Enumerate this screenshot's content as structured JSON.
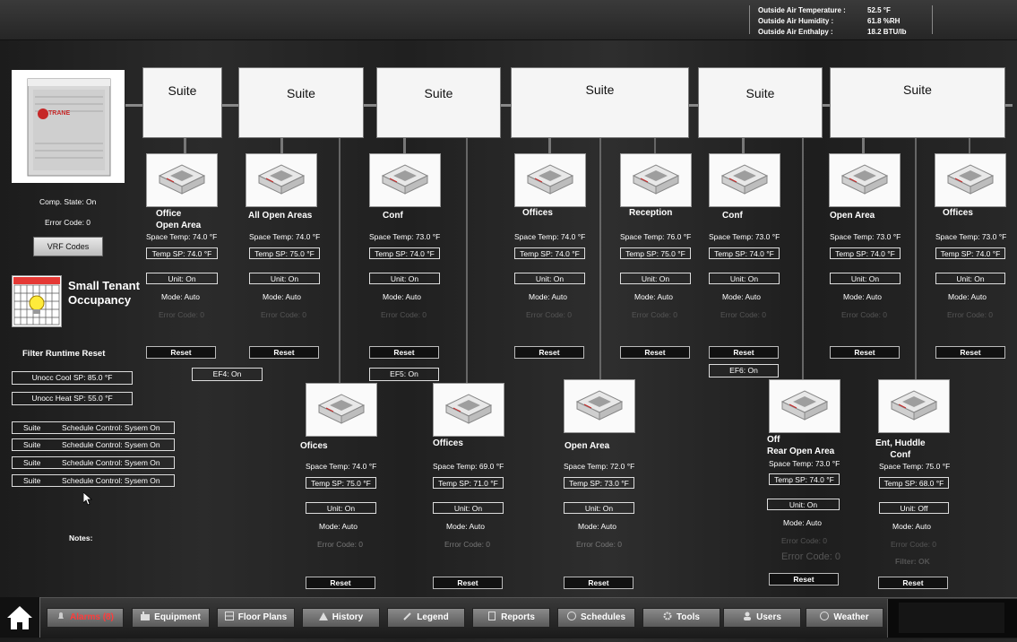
{
  "outside_air": [
    {
      "label": "Outside Air Temperature :",
      "value": "52.5 °F"
    },
    {
      "label": "Outside Air Humidity :",
      "value": "61.8 %RH"
    },
    {
      "label": "Outside Air Enthalpy :",
      "value": "18.2 BTU/lb"
    }
  ],
  "vrf": {
    "comp_state": "Comp. State: On",
    "error_code": "Error Code: 0",
    "codes_button": "VRF Codes",
    "logo": "TRANE"
  },
  "occupancy": {
    "title_line1": "Small Tenant",
    "title_line2": "Occupancy"
  },
  "filter": {
    "title": "Filter Runtime Reset",
    "unocc_cool": "Unocc Cool SP: 85.0 °F",
    "unocc_heat": "Unocc Heat SP: 55.0 °F"
  },
  "schedules": [
    {
      "name": "Suite",
      "status": "Schedule Control: Sysem On"
    },
    {
      "name": "Suite",
      "status": "Schedule Control: Sysem On"
    },
    {
      "name": "Suite",
      "status": "Schedule Control: Sysem On"
    },
    {
      "name": "Suite",
      "status": "Schedule Control: Sysem On"
    }
  ],
  "notes_label": "Notes:",
  "suites": [
    "Suite",
    "Suite",
    "Suite",
    "Suite",
    "Suite",
    "Suite"
  ],
  "exhaust_fans": [
    "EF4: On",
    "EF5: On",
    "EF6: On"
  ],
  "units": {
    "u1": {
      "name": "Office\nOpen Area",
      "space": "Space Temp: 74.0 °F",
      "sp": "Temp SP: 74.0 °F",
      "unit": "Unit: On",
      "mode": "Mode: Auto",
      "err": "Error Code: 0",
      "reset": "Reset"
    },
    "u2": {
      "name": "All Open Areas",
      "space": "Space Temp: 74.0 °F",
      "sp": "Temp SP: 75.0 °F",
      "unit": "Unit: On",
      "mode": "Mode: Auto",
      "err": "Error Code: 0",
      "reset": "Reset"
    },
    "u3": {
      "name": "Conf",
      "space": "Space Temp: 73.0 °F",
      "sp": "Temp SP: 74.0 °F",
      "unit": "Unit: On",
      "mode": "Mode: Auto",
      "err": "Error Code: 0",
      "reset": "Reset"
    },
    "u4": {
      "name": "Offices",
      "space": "Space Temp: 74.0 °F",
      "sp": "Temp SP: 74.0 °F",
      "unit": "Unit: On",
      "mode": "Mode: Auto",
      "err": "Error Code: 0",
      "reset": "Reset"
    },
    "u5": {
      "name": "Reception",
      "space": "Space Temp: 76.0 °F",
      "sp": "Temp SP: 75.0 °F",
      "unit": "Unit: On",
      "mode": "Mode: Auto",
      "err": "Error Code: 0",
      "reset": "Reset"
    },
    "u6": {
      "name": "Conf",
      "space": "Space Temp: 73.0 °F",
      "sp": "Temp SP: 74.0 °F",
      "unit": "Unit: On",
      "mode": "Mode: Auto",
      "err": "Error Code: 0",
      "reset": "Reset"
    },
    "u7": {
      "name": "Open Area",
      "space": "Space Temp: 73.0 °F",
      "sp": "Temp SP: 74.0 °F",
      "unit": "Unit: On",
      "mode": "Mode: Auto",
      "err": "Error Code: 0",
      "reset": "Reset"
    },
    "u8": {
      "name": "Offices",
      "space": "Space Temp: 73.0 °F",
      "sp": "Temp SP: 74.0 °F",
      "unit": "Unit: On",
      "mode": "Mode: Auto",
      "err": "Error Code: 0",
      "reset": "Reset"
    },
    "u9": {
      "name": "Ofices",
      "space": "Space Temp: 74.0 °F",
      "sp": "Temp SP: 75.0 °F",
      "unit": "Unit: On",
      "mode": "Mode: Auto",
      "err": "Error Code: 0",
      "reset": "Reset"
    },
    "u10": {
      "name": "Offices",
      "space": "Space Temp: 69.0 °F",
      "sp": "Temp SP: 71.0 °F",
      "unit": "Unit: On",
      "mode": "Mode: Auto",
      "err": "Error Code: 0",
      "reset": "Reset"
    },
    "u11": {
      "name": "Open Area",
      "space": "Space Temp: 72.0 °F",
      "sp": "Temp SP: 73.0 °F",
      "unit": "Unit: On",
      "mode": "Mode: Auto",
      "err": "Error Code: 0",
      "reset": "Reset"
    },
    "u12": {
      "name": "Off\nRear Open Area",
      "space": "Space Temp: 73.0 °F",
      "sp": "Temp SP: 74.0 °F",
      "unit": "Unit: On",
      "mode": "Mode: Auto",
      "err": "Error Code: 0",
      "err2": "Error Code: 0",
      "reset": "Reset"
    },
    "u13": {
      "name": "Ent, Huddle\nConf",
      "space": "Space Temp: 75.0 °F",
      "sp": "Temp SP: 68.0 °F",
      "unit": "Unit: Off",
      "mode": "Mode: Auto",
      "err": "Error Code: 0",
      "filter": "Filter: OK",
      "reset": "Reset"
    }
  },
  "nav": {
    "alarms": "Alarms (8)",
    "equipment": "Equipment",
    "floor_plans": "Floor Plans",
    "history": "History",
    "legend": "Legend",
    "reports": "Reports",
    "schedules": "Schedules",
    "tools": "Tools",
    "users": "Users",
    "weather": "Weather"
  },
  "colors": {
    "alarm": "#e53935",
    "bus": "#888888",
    "suite_bg": "#f5f5f5"
  }
}
